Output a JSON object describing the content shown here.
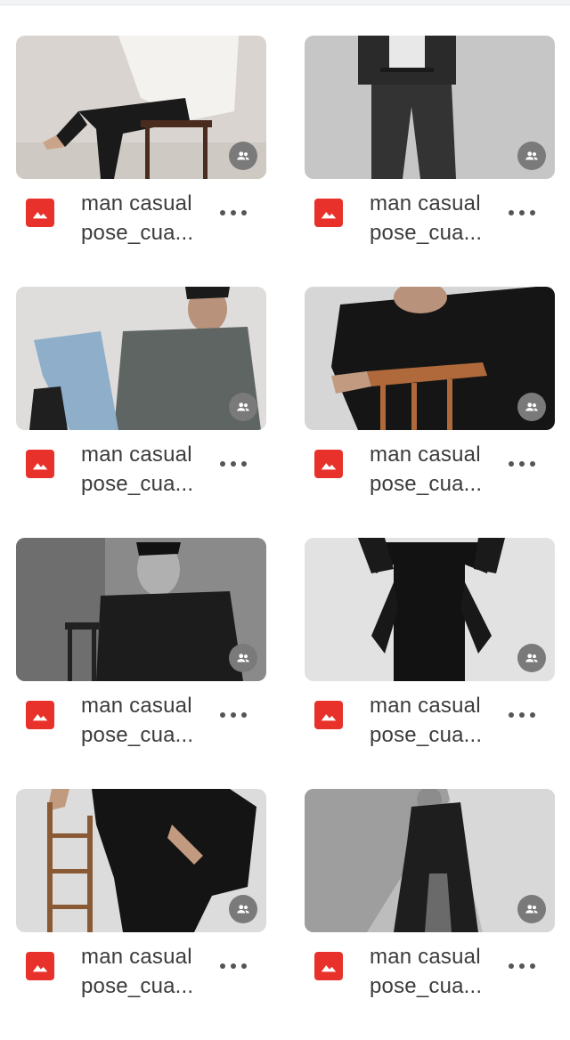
{
  "files": [
    {
      "name_line1": "man casual",
      "name_line2": "pose_cua...",
      "file_type_icon": "image-icon",
      "shared_icon": "shared-people-icon",
      "more_icon": "more-dots-icon"
    },
    {
      "name_line1": "man casual",
      "name_line2": "pose_cua...",
      "file_type_icon": "image-icon",
      "shared_icon": "shared-people-icon",
      "more_icon": "more-dots-icon"
    },
    {
      "name_line1": "man casual",
      "name_line2": "pose_cua...",
      "file_type_icon": "image-icon",
      "shared_icon": "shared-people-icon",
      "more_icon": "more-dots-icon"
    },
    {
      "name_line1": "man casual",
      "name_line2": "pose_cua...",
      "file_type_icon": "image-icon",
      "shared_icon": "shared-people-icon",
      "more_icon": "more-dots-icon"
    },
    {
      "name_line1": "man casual",
      "name_line2": "pose_cua...",
      "file_type_icon": "image-icon",
      "shared_icon": "shared-people-icon",
      "more_icon": "more-dots-icon"
    },
    {
      "name_line1": "man casual",
      "name_line2": "pose_cua...",
      "file_type_icon": "image-icon",
      "shared_icon": "shared-people-icon",
      "more_icon": "more-dots-icon"
    },
    {
      "name_line1": "man casual",
      "name_line2": "pose_cua...",
      "file_type_icon": "image-icon",
      "shared_icon": "shared-people-icon",
      "more_icon": "more-dots-icon"
    },
    {
      "name_line1": "man casual",
      "name_line2": "pose_cua...",
      "file_type_icon": "image-icon",
      "shared_icon": "shared-people-icon",
      "more_icon": "more-dots-icon"
    }
  ],
  "colors": {
    "file_icon_bg": "#e8312a",
    "shared_badge_bg": "#7a7a7a",
    "title_text": "#3c3c3c"
  }
}
